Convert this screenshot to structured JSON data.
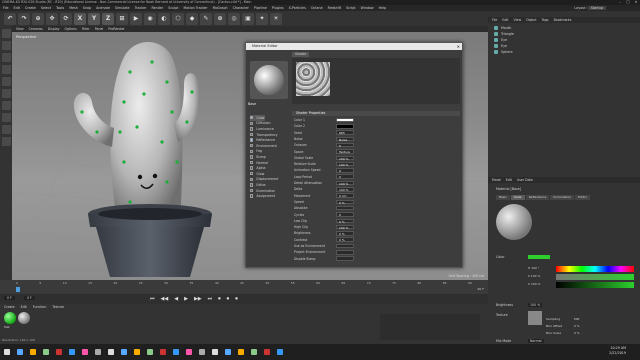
{
  "window": {
    "title": "CINEMA 4D R20.026 Studio (RC - R20) (Educational License - Non-Commercial License for Noah Bernard at University of Connecticut) - [Cactus.c4d *] - Main",
    "controls": [
      "–",
      "□",
      "✕"
    ]
  },
  "menubar": [
    "File",
    "Edit",
    "Create",
    "Select",
    "Tools",
    "Mesh",
    "Snap",
    "Animate",
    "Simulate",
    "Tracker",
    "Render",
    "Sculpt",
    "Motion Tracker",
    "MoGraph",
    "Character",
    "Pipeline",
    "Plugins",
    "X-Particles",
    "Octane",
    "Redshift",
    "Script",
    "Window",
    "Help"
  ],
  "layout": {
    "label": "Layout:",
    "value": "Startup"
  },
  "toolbar": [
    "↶",
    "↷",
    "⊕",
    "✥",
    "⟳",
    "X",
    "Y",
    "Z",
    "⊞",
    "▶",
    "◉",
    "◐",
    "⬡",
    "◆",
    "✎",
    "⊛",
    "◎",
    "▣",
    "✦",
    "☀"
  ],
  "viewport": {
    "menu": [
      "View",
      "Cameras",
      "Display",
      "Options",
      "Filter",
      "Panel",
      "ProRender"
    ],
    "label": "Perspective",
    "grid_spacing": "Grid Spacing : 100 cm"
  },
  "timeline": {
    "ticks": [
      "0",
      "5",
      "10",
      "15",
      "20",
      "25",
      "30",
      "35",
      "40",
      "45",
      "50",
      "55",
      "60",
      "65",
      "70",
      "75",
      "80",
      "85",
      "90"
    ],
    "start": "0 F",
    "end": "90 F",
    "current": "0 F"
  },
  "transport": [
    "⏮",
    "◀◀",
    "◀",
    "▶",
    "▶▶",
    "⏭",
    "⏺",
    "⏺",
    "⏺"
  ],
  "bottom_panel": {
    "menu": [
      "Create",
      "Edit",
      "Function",
      "Texture"
    ],
    "material_label": "Mat",
    "status": "Revolution: 100 x 100"
  },
  "objects": {
    "menu": [
      "File",
      "Edit",
      "View",
      "Object",
      "Tags",
      "Bookmarks"
    ],
    "items": [
      "Mouth",
      "Triangle",
      "Eye",
      "Eye",
      "Sphere"
    ]
  },
  "attributes": {
    "menu": [
      "Mode",
      "Edit",
      "User Data"
    ],
    "material_title": "Material [Base]",
    "tabs": [
      "Basic",
      "Color",
      "Reflectance",
      "Illumination",
      "Editor"
    ],
    "color_label": "Color",
    "color_fields": [
      "H  100 °",
      "S  100 %",
      "V  100 %"
    ],
    "brightness_label": "Brightness",
    "brightness_value": "100 %",
    "texture_label": "Texture",
    "sampling_label": "Sampling",
    "sampling_value": "MIP",
    "blur_offset_label": "Blur Offset",
    "blur_offset_value": "0 %",
    "blur_scale_label": "Blur Scale",
    "blur_scale_value": "0 %",
    "mix_mode_label": "Mix Mode",
    "mix_mode_value": "Normal"
  },
  "material_editor": {
    "title": "Material Editor",
    "name": "Base",
    "tab": "Shader",
    "channels": [
      {
        "label": "Color",
        "on": true
      },
      {
        "label": "Diffusion",
        "on": false
      },
      {
        "label": "Luminance",
        "on": false
      },
      {
        "label": "Transparency",
        "on": false
      },
      {
        "label": "Reflectance",
        "on": true
      },
      {
        "label": "Environment",
        "on": false
      },
      {
        "label": "Fog",
        "on": false
      },
      {
        "label": "Bump",
        "on": false
      },
      {
        "label": "Normal",
        "on": false
      },
      {
        "label": "Alpha",
        "on": false
      },
      {
        "label": "Glow",
        "on": false
      },
      {
        "label": "Displacement",
        "on": false
      },
      {
        "label": "Editor",
        "on": false
      },
      {
        "label": "Illumination",
        "on": false
      },
      {
        "label": "Assignment",
        "on": false
      }
    ],
    "section": "Shader Properties",
    "properties": [
      {
        "label": "Color 1",
        "value": ""
      },
      {
        "label": "Color 2",
        "value": ""
      },
      {
        "label": "Seed",
        "value": "665"
      },
      {
        "label": "Noise",
        "value": "Noise"
      },
      {
        "label": "Octaves",
        "value": "5"
      },
      {
        "label": "Space",
        "value": "Texture"
      },
      {
        "label": "Global Scale",
        "value": "100 %"
      },
      {
        "label": "Relative Scale",
        "value": "100 %"
      },
      {
        "label": "Animation Speed",
        "value": "0"
      },
      {
        "label": "Loop Period",
        "value": "0"
      },
      {
        "label": "Detail Attenuation",
        "value": "100 %"
      },
      {
        "label": "Delta",
        "value": "100 %"
      },
      {
        "label": "Movement",
        "value": "0 cm"
      },
      {
        "label": "Speed",
        "value": "0 %"
      },
      {
        "label": "Absolute",
        "value": ""
      },
      {
        "label": "Cycles",
        "value": "0"
      },
      {
        "label": "Low Clip",
        "value": "0 %"
      },
      {
        "label": "High Clip",
        "value": "100 %"
      },
      {
        "label": "Brightness",
        "value": "0 %"
      },
      {
        "label": "Contrast",
        "value": "0 %"
      },
      {
        "label": "Use as Environment",
        "value": ""
      },
      {
        "label": "Project Environment",
        "value": ""
      },
      {
        "label": "Disable Bump",
        "value": ""
      }
    ]
  },
  "clock": {
    "time": "10:29 AM",
    "date": "2/22/2019"
  },
  "colors": {
    "accent": "#4ea0e0",
    "cactus": "#c9c9c9",
    "pot": "#4a4f58",
    "spine": "#19b03a"
  }
}
